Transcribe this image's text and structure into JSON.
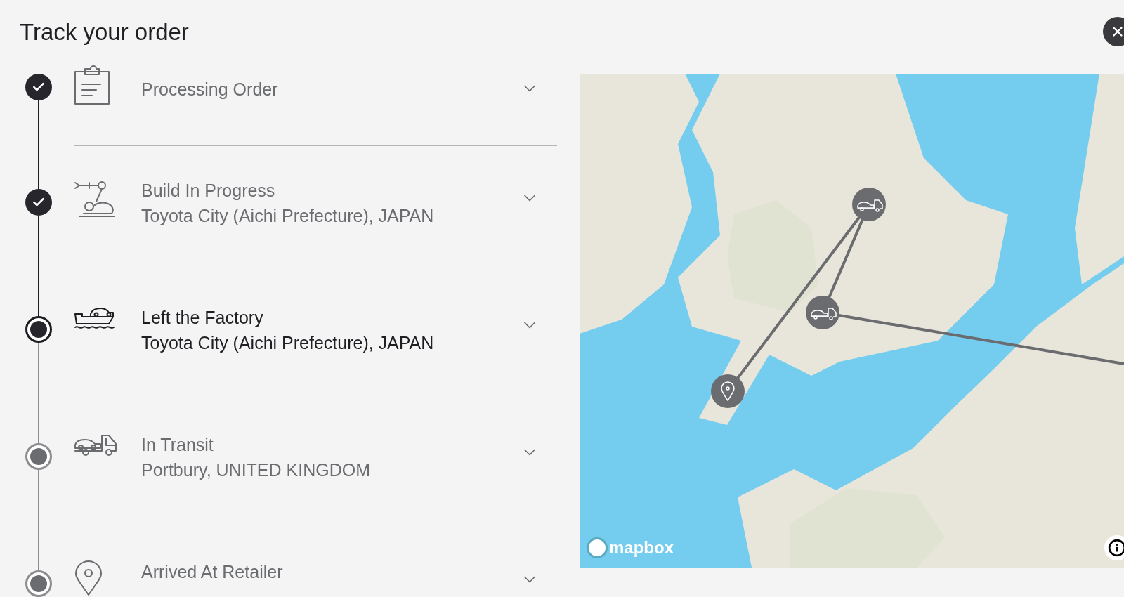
{
  "title": "Track your order",
  "steps": [
    {
      "kind": "clipboard",
      "completed": true,
      "current": false,
      "title": "Processing Order"
    },
    {
      "kind": "robot",
      "completed": true,
      "current": false,
      "title": "Build In Progress",
      "location": "Toyota City (Aichi Prefecture), JAPAN"
    },
    {
      "kind": "ship",
      "completed": false,
      "current": true,
      "title": "Left the Factory",
      "location": "Toyota City (Aichi Prefecture), JAPAN"
    },
    {
      "kind": "truck",
      "completed": false,
      "current": false,
      "title": "In Transit",
      "location": "Portbury, UNITED KINGDOM"
    },
    {
      "kind": "pin",
      "completed": false,
      "current": false,
      "title": "Arrived At Retailer"
    }
  ],
  "map": {
    "attribution": "mapbox"
  }
}
